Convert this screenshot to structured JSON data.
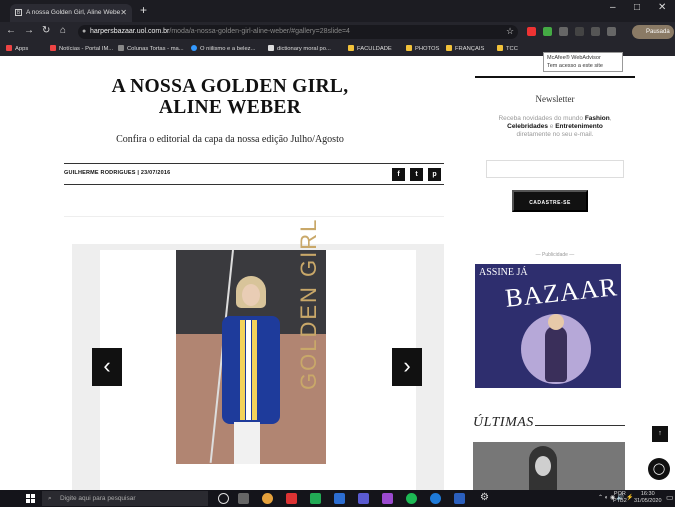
{
  "browser": {
    "tab_title": "A nossa Golden Girl, Aline Webe",
    "tab_close": "✕",
    "new_tab": "+",
    "url_domain": "harpersbazaar.uol.com.br",
    "url_path": "/moda/a-nossa-golden-girl-aline-weber/#gallery=28slide=4",
    "profile_label": "Pausada",
    "bookmarks": [
      "Apps",
      "Notícias - Portal IM...",
      "Colunas Tortas - ma...",
      "O niilismo e a belez...",
      "dictionary moral po...",
      "FACULDADE",
      "PHOTOS",
      "FRANÇAIS",
      "TCC"
    ],
    "tooltip_title": "McAfee® WebAdvisor",
    "tooltip_text": "Tem acesso a este site"
  },
  "article": {
    "title": "A NOSSA GOLDEN GIRL, ALINE WEBER",
    "subtitle": "Confira o editorial da capa da nossa edição Julho/Agosto",
    "byline": "GUILHERME RODRIGUES  |  23/07/2016",
    "share_icons": [
      "f",
      "t",
      "p"
    ]
  },
  "gallery": {
    "overlay_text": "GOLDEN GIRL",
    "prev": "‹",
    "next": "›"
  },
  "sidebar": {
    "newsletter_title": "Newsletter",
    "newsletter_text_1": "Receba novidades do mundo ",
    "newsletter_bold_1": "Fashion",
    "newsletter_bold_2": "Celebridades",
    "newsletter_text_2": " e ",
    "newsletter_bold_3": "Entretenimento",
    "newsletter_text_3": " diretamente no seu e-mail.",
    "subscribe_label": "CADASTRE-SE",
    "ad_label": "— Publicidade —",
    "ad_assine": "ASSINE JÁ",
    "ad_brand": "BAZAAR",
    "latest_title": "ÚLTIMAS",
    "scroll_top": "↑"
  },
  "taskbar": {
    "search_placeholder": "Digite aqui para pesquisar",
    "lang": "POR",
    "lang2": "PTB2",
    "time": "16:30",
    "date": "31/05/2020"
  },
  "colors": {
    "browser_bg": "#1c1c22",
    "accent_gold": "#c9a869",
    "jacket_blue": "#1e3b9b",
    "ad_bg": "#2e2e6e"
  }
}
